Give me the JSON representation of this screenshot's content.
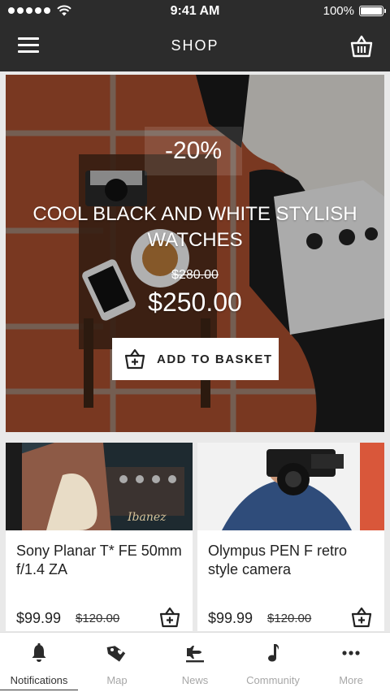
{
  "status_bar": {
    "time": "9:41 AM",
    "battery": "100%"
  },
  "app_bar": {
    "title": "SHOP"
  },
  "hero": {
    "discount": "-20%",
    "title": "COOL BLACK AND WHITE STYLISH WATCHES",
    "old_price": "$280.00",
    "price": "$250.00",
    "button_label": "ADD TO BASKET"
  },
  "products": [
    {
      "title": "Sony Planar T* FE 50mm f/1.4 ZA",
      "price": "$99.99",
      "old_price": "$120.00"
    },
    {
      "title": "Olympus PEN F retro style camera",
      "price": "$99.99",
      "old_price": "$120.00"
    }
  ],
  "tabs": [
    {
      "label": "Notifications",
      "icon": "bell-icon",
      "active": true
    },
    {
      "label": "Map",
      "icon": "tag-icon",
      "active": false
    },
    {
      "label": "News",
      "icon": "plane-icon",
      "active": false
    },
    {
      "label": "Community",
      "icon": "music-note-icon",
      "active": false
    },
    {
      "label": "More",
      "icon": "more-dots-icon",
      "active": false
    }
  ]
}
